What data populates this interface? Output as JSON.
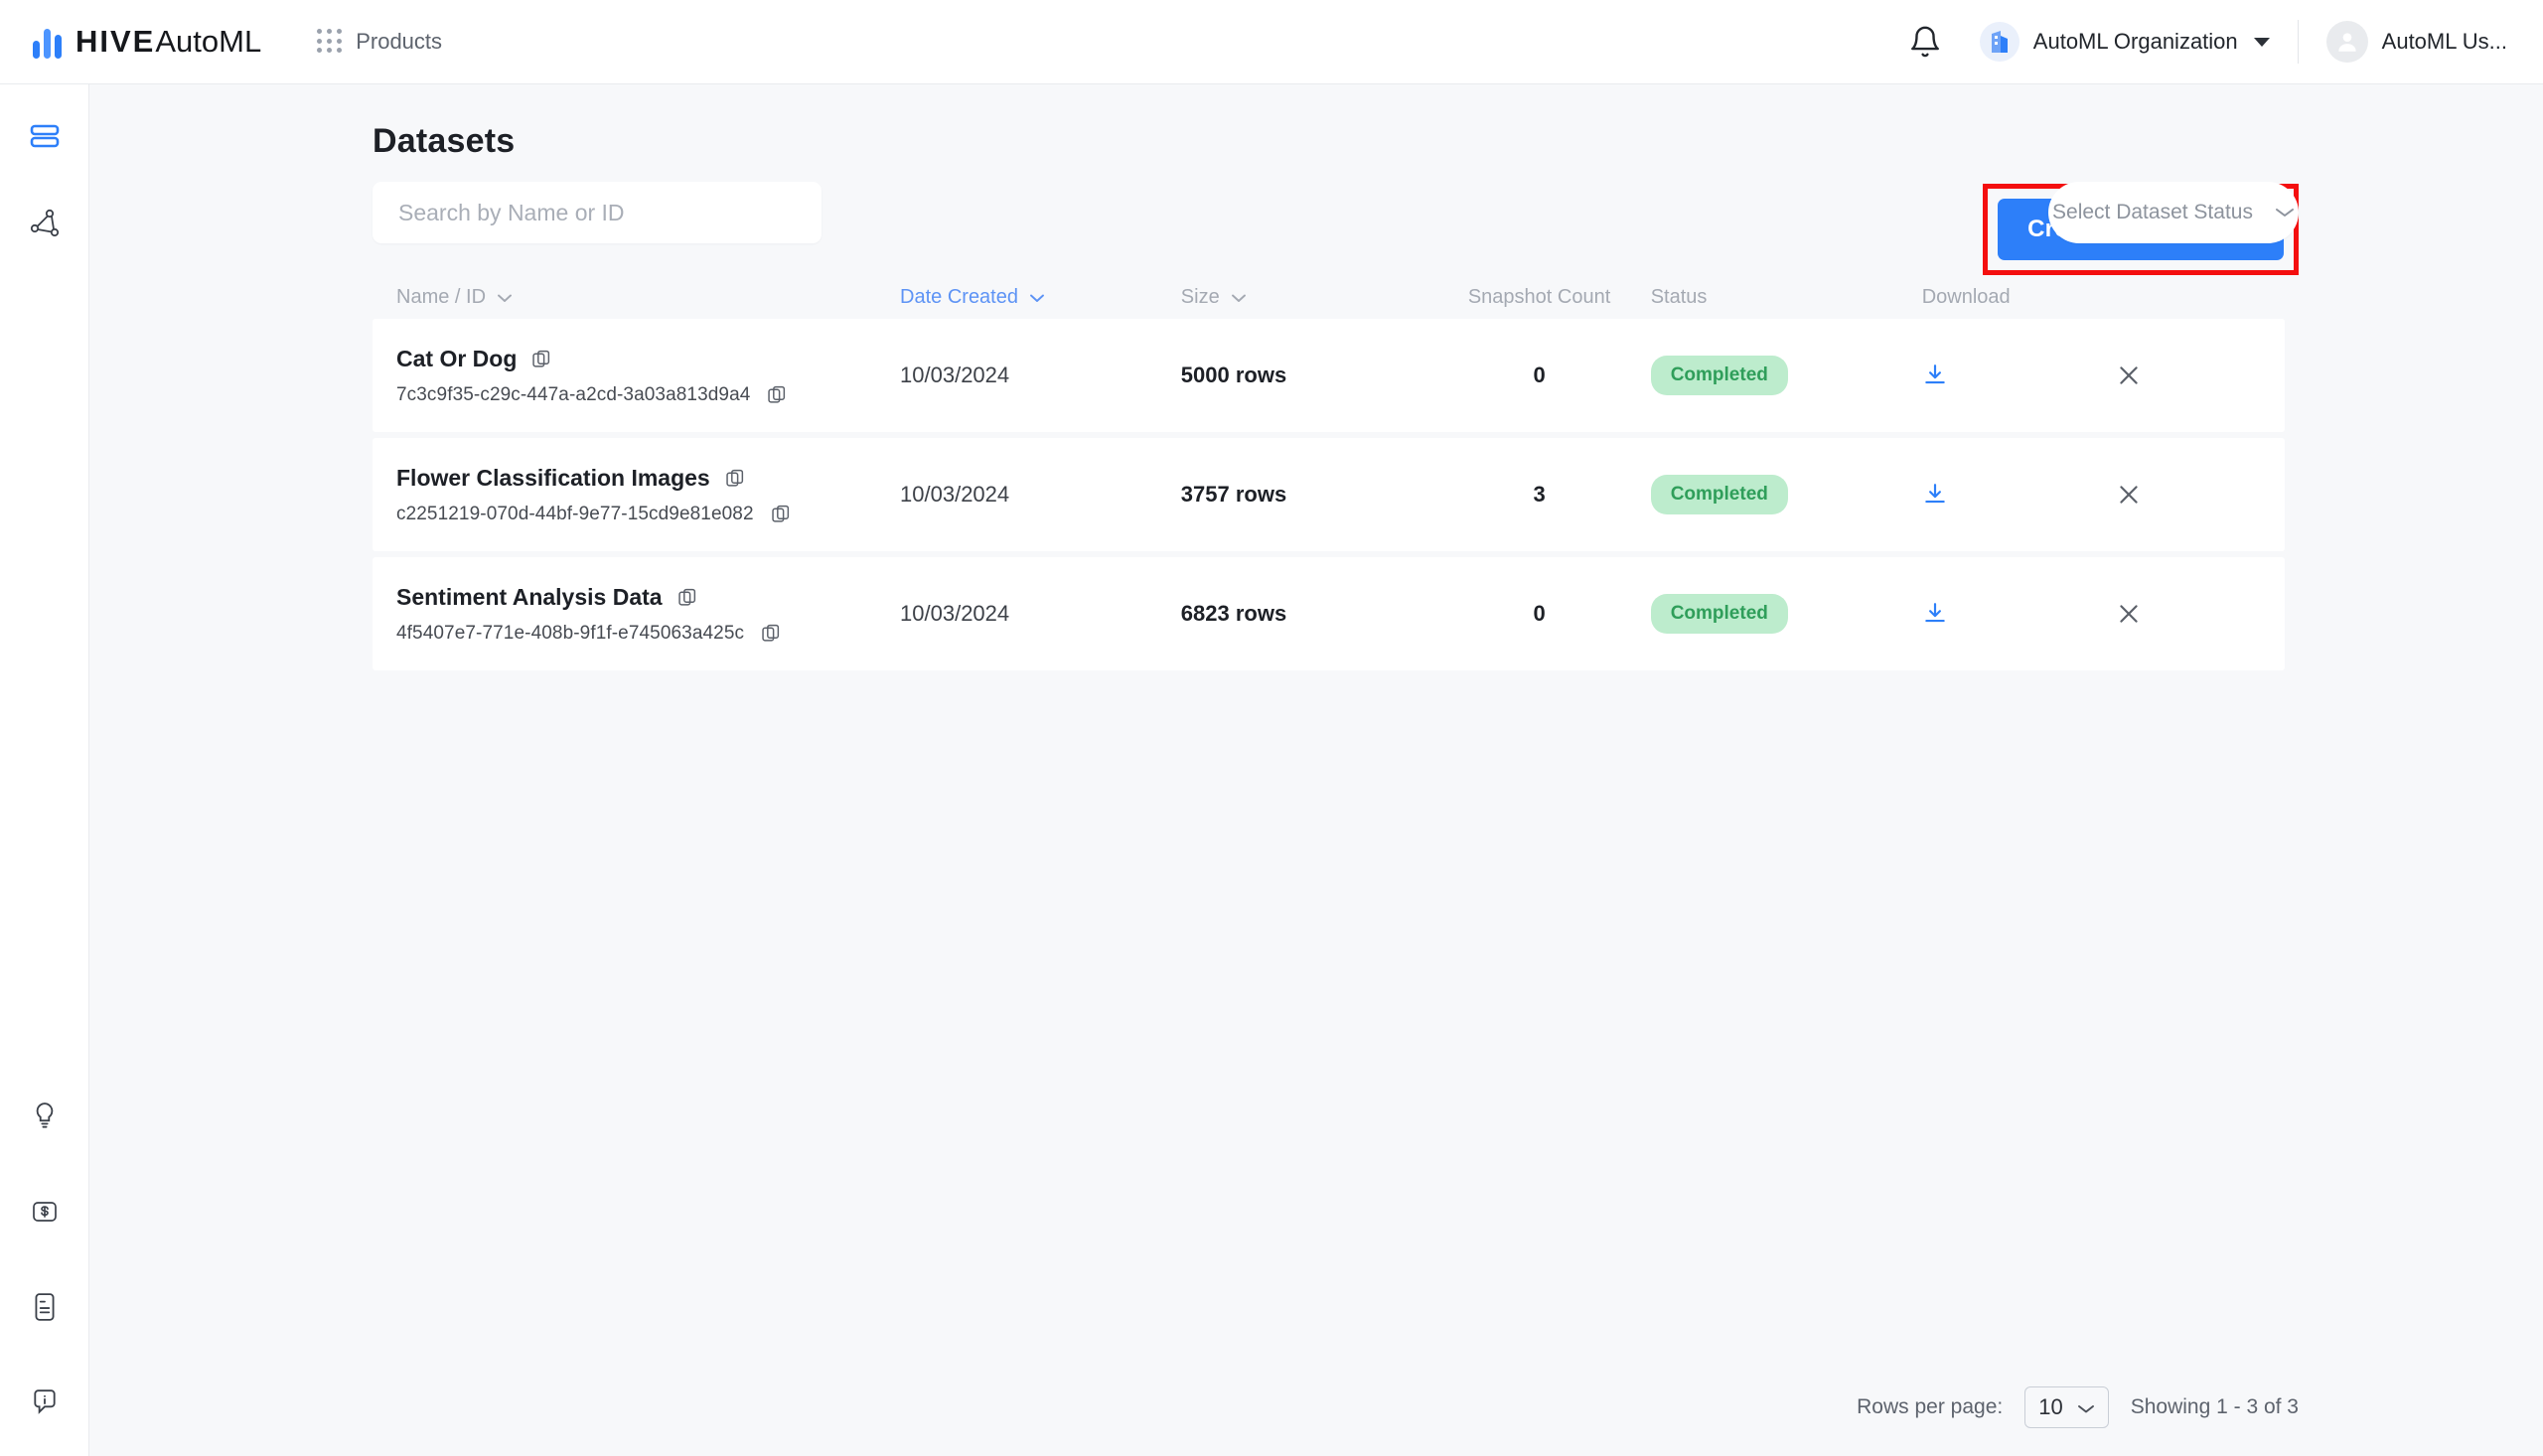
{
  "header": {
    "brand_bold": "HIVE",
    "brand_light": "AutoML",
    "products_label": "Products",
    "notifications_icon": "bell-icon",
    "org_name": "AutoML Organization",
    "user_name": "AutoML Us...",
    "org_icon": "building-icon",
    "avatar_icon": "user-avatar-icon"
  },
  "sidebar": {
    "top_items": [
      {
        "name": "datasets",
        "icon": "datasets-stack-icon",
        "active": true
      },
      {
        "name": "models",
        "icon": "model-graph-icon",
        "active": false
      }
    ],
    "bottom_items": [
      {
        "name": "tips",
        "icon": "lightbulb-icon"
      },
      {
        "name": "billing",
        "icon": "dollar-card-icon"
      },
      {
        "name": "docs",
        "icon": "document-icon"
      },
      {
        "name": "support",
        "icon": "info-chat-icon"
      }
    ]
  },
  "page": {
    "title": "Datasets",
    "create_button_label": "Create New Dataset",
    "highlight_color": "#f40f0f",
    "accent_color": "#2d7ff9"
  },
  "search": {
    "value": "",
    "placeholder": "Search by Name or ID"
  },
  "status_filter": {
    "label": "Select Dataset Status",
    "chevron_icon": "chevron-down-icon"
  },
  "table": {
    "columns": [
      {
        "label": "Name / ID",
        "sortable": true,
        "active": false
      },
      {
        "label": "Date Created",
        "sortable": true,
        "active": true
      },
      {
        "label": "Size",
        "sortable": true,
        "active": false
      },
      {
        "label": "Snapshot Count",
        "sortable": false,
        "active": false
      },
      {
        "label": "Status",
        "sortable": false,
        "active": false
      },
      {
        "label": "Download",
        "sortable": false,
        "active": false
      }
    ],
    "rows": [
      {
        "name": "Cat Or Dog",
        "id": "7c3c9f35-c29c-447a-a2cd-3a03a813d9a4",
        "date_created": "10/03/2024",
        "size": "5000 rows",
        "snapshot_count": "0",
        "status": "Completed"
      },
      {
        "name": "Flower Classification Images",
        "id": "c2251219-070d-44bf-9e77-15cd9e81e082",
        "date_created": "10/03/2024",
        "size": "3757 rows",
        "snapshot_count": "3",
        "status": "Completed"
      },
      {
        "name": "Sentiment Analysis Data",
        "id": "4f5407e7-771e-408b-9f1f-e745063a425c",
        "date_created": "10/03/2024",
        "size": "6823 rows",
        "snapshot_count": "0",
        "status": "Completed"
      }
    ]
  },
  "footer": {
    "rows_per_page_label": "Rows per page:",
    "rows_per_page_value": "10",
    "showing_text": "Showing 1 - 3 of 3"
  }
}
